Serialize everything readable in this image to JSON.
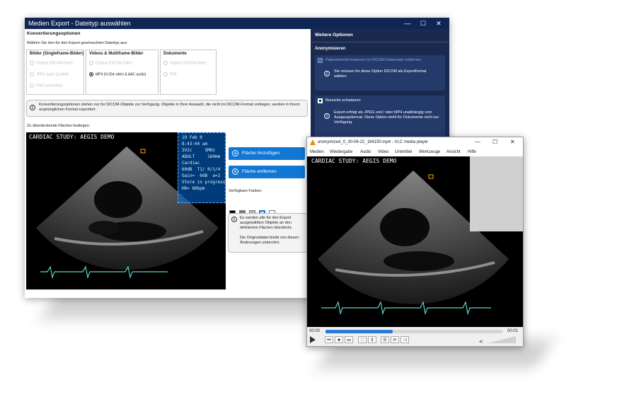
{
  "export_window": {
    "title": "Medien Export - Dateityp auswählen",
    "controls": {
      "minimize": "—",
      "maximize": "☐",
      "close": "✕"
    },
    "conversion_header": "Konvertierungsoptionen",
    "instruction": "Wählen Sie den für den Export gewünschten Dateityp aus:",
    "groups": [
      {
        "title": "Bilder (Singleframe-Bilder)",
        "options": [
          "Original (DICOM-Datei)",
          "JPEG (gute Qualität)",
          "PNG (verlustfrei)"
        ]
      },
      {
        "title": "Videos & Multiframe-Bilder",
        "options": [
          "Original (DICOM-Datei)",
          "MP4 (H.264 video & AAC audio)"
        ],
        "selected": 1
      },
      {
        "title": "Dokumente",
        "options": [
          "Original (DICOM-Datei)",
          "PDF"
        ]
      }
    ],
    "info_text": "Konvertierungsoptionen stehen nur für DICOM-Objekte zur Verfügung. Objekte in Ihrer Auswahl, die nicht im DICOM-Format vorliegen, werden in ihrem ursprünglichen Format exportiert.",
    "overlay_label": "Zu überdeckende Flächen festlegen:",
    "ultrasound": {
      "study_text": "CARDIAC STUDY: AEGIS DEMO",
      "overlay_lines": [
        "19 Feb 0",
        "8:43:44 am",
        "3V2c     5MHz",
        "ADULT     160mm",
        "Cardiac",
        "60dB  T1/ 0/1/4",
        "Gain=  0dB  a=2",
        "Store in progress",
        "HR= 60bpm"
      ]
    },
    "add_button": "Fläche hinzufügen",
    "remove_button": "Fläche entfernen",
    "colors_label": "Verfügbare Farben:",
    "color_swatches": [
      "#000000",
      "#7a7a7a",
      "#b9b9b9",
      "#e2e2e2",
      "#ffffff"
    ],
    "side_info": "Es werden alle für den Export ausgewählten Objekte an den definierten Flächen überdeckt.",
    "side_info2": "Die Originaldatei bleibt von diesen Änderungen unberührt.",
    "further_options": "Weitere Optionen",
    "anonymize": "Anonymisieren",
    "remove_patient_info": "Patienteninformationen im DICOM-Datensatz entfernen",
    "remove_patient_info_note": "Sie müssen für diese Option DICOM als Exportformat wählen.",
    "blacken_areas": "Bereiche schwärzen",
    "blacken_note": "Export erfolgt als JPEG und / oder MP4 unabhängig vom Ausgangsformat. Diese Option steht für Dokumente nicht zur Verfügung."
  },
  "vlc_window": {
    "title": "anonymized_0_30-06-22_164150.mp4 - VLC media player",
    "controls": {
      "minimize": "—",
      "maximize": "☐",
      "close": "✕"
    },
    "menu": [
      "Medien",
      "Wiedergabe",
      "Audio",
      "Video",
      "Untertitel",
      "Werkzeuge",
      "Ansicht",
      "Hilfe"
    ],
    "study_text": "CARDIAC STUDY: AEGIS DEMO",
    "time_start": "00:00",
    "time_end": "00:01",
    "progress": 0.38,
    "volume_label": "◢",
    "controls_icons": [
      "play-icon",
      "prev-icon",
      "stop-icon",
      "next-icon",
      "fullscreen-icon",
      "equalizer-icon",
      "playlist-icon",
      "loop-icon",
      "shuffle-icon"
    ]
  }
}
